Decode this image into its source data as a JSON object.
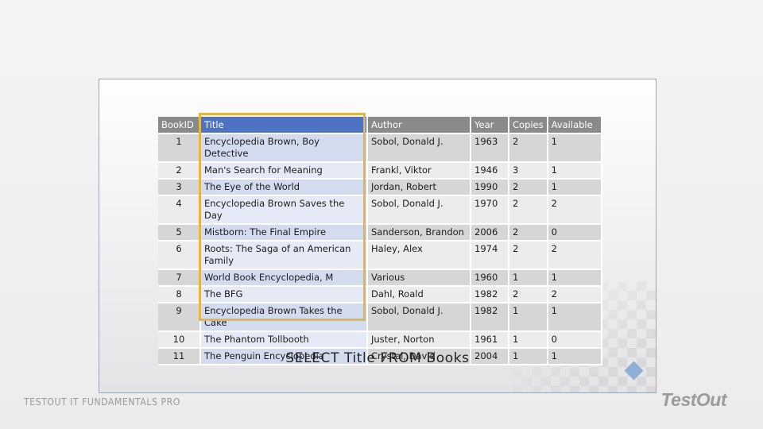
{
  "table": {
    "headers": [
      "BookID",
      "Title",
      "Author",
      "Year",
      "Copies",
      "Available"
    ],
    "rows": [
      [
        "1",
        "Encyclopedia Brown, Boy Detective",
        "Sobol, Donald J.",
        "1963",
        "2",
        "1"
      ],
      [
        "2",
        "Man's Search for Meaning",
        "Frankl, Viktor",
        "1946",
        "3",
        "1"
      ],
      [
        "3",
        "The Eye of the World",
        "Jordan, Robert",
        "1990",
        "2",
        "1"
      ],
      [
        "4",
        "Encyclopedia Brown Saves the Day",
        "Sobol, Donald J.",
        "1970",
        "2",
        "2"
      ],
      [
        "5",
        "Mistborn: The Final Empire",
        "Sanderson, Brandon",
        "2006",
        "2",
        "0"
      ],
      [
        "6",
        "Roots: The Saga of an American Family",
        "Haley, Alex",
        "1974",
        "2",
        "2"
      ],
      [
        "7",
        "World Book Encyclopedia, M",
        "Various",
        "1960",
        "1",
        "1"
      ],
      [
        "8",
        "The BFG",
        "Dahl, Roald",
        "1982",
        "2",
        "2"
      ],
      [
        "9",
        "Encyclopedia Brown Takes the Cake",
        "Sobol, Donald J.",
        "1982",
        "1",
        "1"
      ],
      [
        "10",
        "The Phantom Tollbooth",
        "Juster, Norton",
        "1961",
        "1",
        "0"
      ],
      [
        "11",
        "The Penguin Encyclopedia",
        "Crystal, David",
        "2004",
        "1",
        "1"
      ]
    ]
  },
  "query": "SELECT Title FROM Books",
  "footer": {
    "course": "TESTOUT IT FUNDAMENTALS PRO",
    "logo": "TestOut"
  },
  "colors": {
    "title_header": "#4d73c2",
    "highlight_border": "#e6b54a",
    "header_gray": "#8a8a8a"
  }
}
